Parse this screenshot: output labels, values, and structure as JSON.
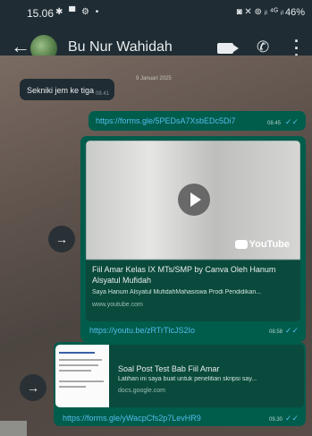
{
  "status_bar": {
    "time": "15.06",
    "left_icons": "✱ ▀ ⚙ •",
    "right_icons": "◙ ✕ ⊚ ᵢₗ ⁴ᴳ ᵢₗ",
    "battery": "46%"
  },
  "header": {
    "back_icon": "arrow-left-icon",
    "contact_name": "Bu Nur Wahidah",
    "video_icon": "video-call-icon",
    "call_icon": "phone-icon",
    "menu_icon": "more-vertical-icon"
  },
  "date_chip": "9 Januari 2025",
  "incoming": {
    "text": "Sekniki jem ke tiga",
    "time": "08.41"
  },
  "outgoing": [
    {
      "link": "https://forms.gle/5PEDsA7XsbEDc5Di7",
      "time": "08.45",
      "ticks": "✓✓"
    },
    {
      "preview_title": "Fiil Amar Kelas IX MTs/SMP by Canva Oleh Hanum Alsyatul Mufidah",
      "preview_desc": "Saya Hanum Alsyatul MufidahMahasiswa Prodi Pendidikan...",
      "preview_domain": "www.youtube.com",
      "link": "https://youtu.be/zRTrTlcJS2Io",
      "time": "08.58",
      "ticks": "✓✓",
      "brand_text": "YouTube"
    },
    {
      "preview_title": "Soal Post Test Bab Fiil Amar",
      "preview_desc": "Latihan ini saya buat untuk penelitian skripsi say...",
      "preview_domain": "docs.google.com",
      "link": "https://forms.gle/yWacpCfs2p7LevHR9",
      "time": "09.30",
      "ticks": "✓✓"
    }
  ],
  "forward_icon": "→"
}
